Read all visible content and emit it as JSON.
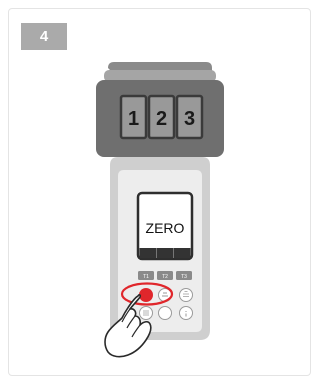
{
  "step": {
    "number": "4"
  },
  "cuvette": {
    "slots": [
      "1",
      "2",
      "3"
    ]
  },
  "meter": {
    "display_text": "ZERO",
    "display_soft_keys": [
      "",
      "",
      ""
    ],
    "tab_labels": [
      "T1",
      "T2",
      "T3"
    ],
    "highlighted_button": "zero-button"
  },
  "colors": {
    "badge": "#aaaaaa",
    "device_dark": "#7a7a7a",
    "device_light": "#e3e3e3",
    "screen_border": "#333333",
    "highlight": "#e0262b"
  },
  "icons": {
    "pointer": "hand-pointer-icon",
    "highlight": "red-ellipse-highlight"
  }
}
